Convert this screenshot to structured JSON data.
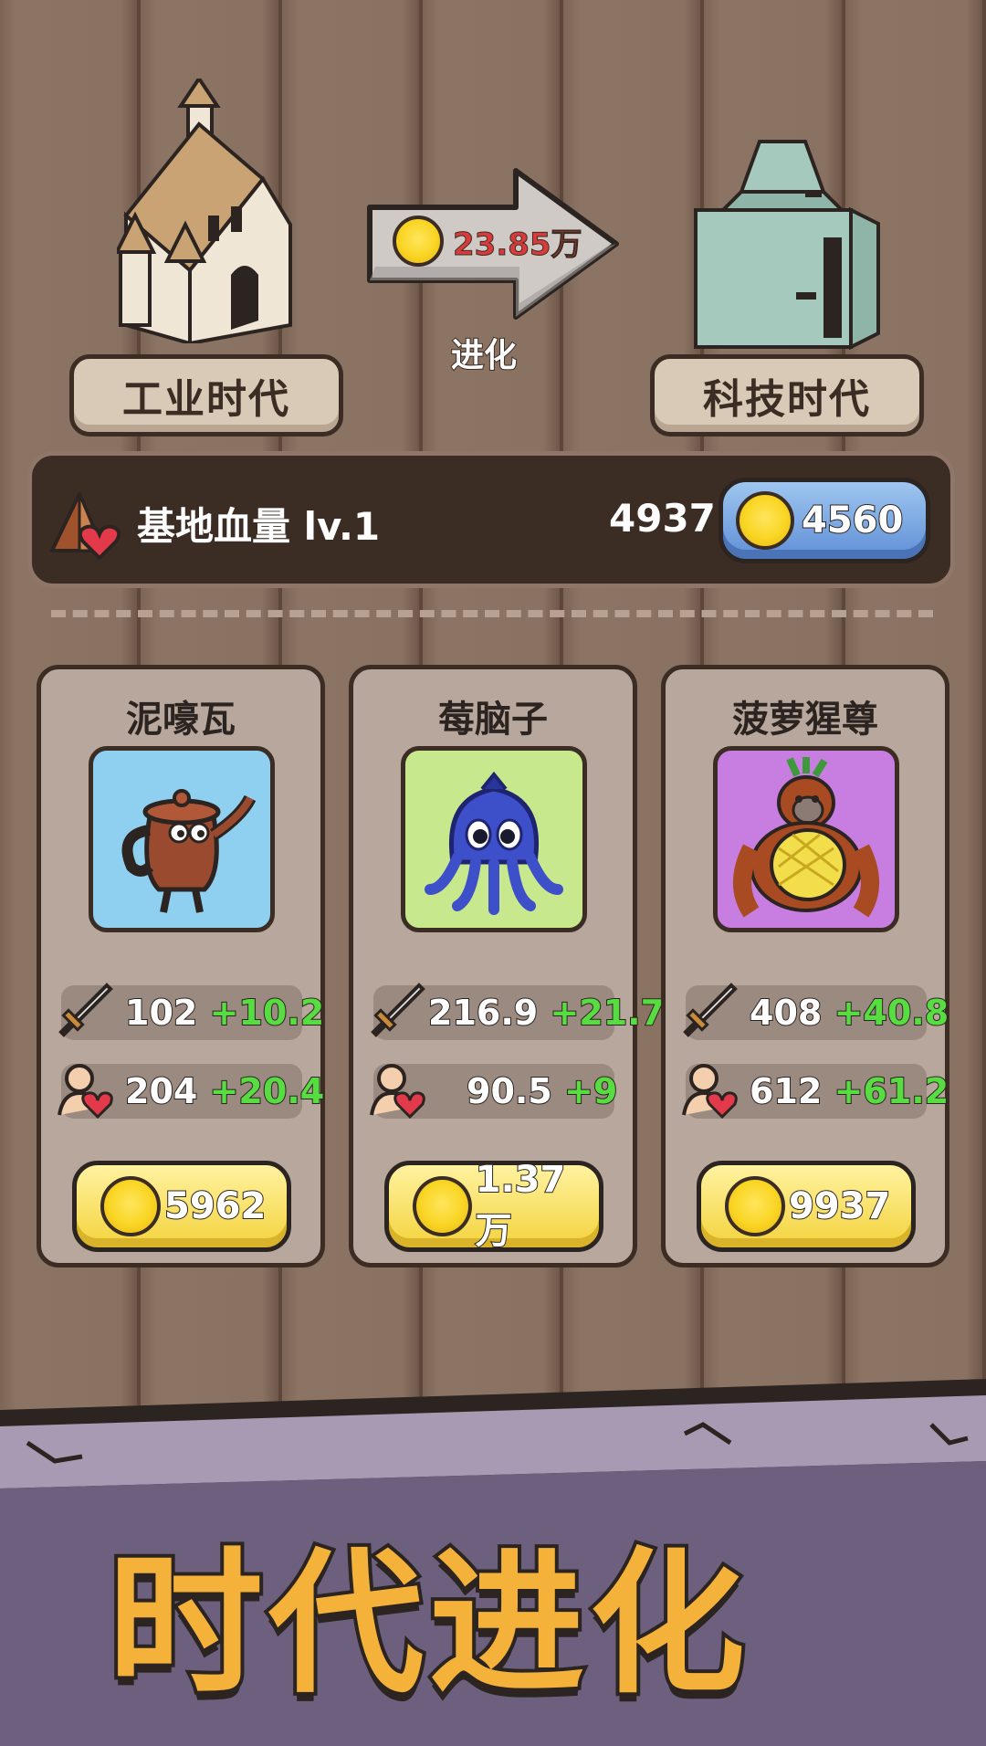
{
  "eras": {
    "current": {
      "label": "工业时代",
      "icon": "castle-building-icon"
    },
    "next": {
      "label": "科技时代",
      "icon": "tech-building-icon"
    },
    "evolve_cost": "23.85万",
    "evolve_label": "进化"
  },
  "base_hp": {
    "label": "基地血量 lv.1",
    "value": "4937",
    "upgrade_cost": "4560",
    "icon": "tent-heart-icon"
  },
  "units": [
    {
      "name": "泥嚎瓦",
      "attack": "102",
      "attack_bonus": "+10.2",
      "hp": "204",
      "hp_bonus": "+20.4",
      "cost": "5962",
      "portrait": "teapot-creature-icon",
      "bg_color": "#8fd0f0"
    },
    {
      "name": "莓脑子",
      "attack": "216.9",
      "attack_bonus": "+21.7",
      "hp": "90.5",
      "hp_bonus": "+9",
      "cost": "1.37万",
      "portrait": "blueberry-octopus-icon",
      "bg_color": "#c8e88e"
    },
    {
      "name": "菠萝猩尊",
      "attack": "408",
      "attack_bonus": "+40.8",
      "hp": "612",
      "hp_bonus": "+61.2",
      "cost": "9937",
      "portrait": "pineapple-gorilla-icon",
      "bg_color": "#c77ee0"
    }
  ],
  "banner": {
    "title": "时代进化"
  },
  "colors": {
    "bonus_green": "#57dc42",
    "cost_red": "#d83b3b",
    "coin_gold": "#f9d523",
    "button_blue": "#5f8fd6",
    "button_yellow": "#f3d33c"
  }
}
